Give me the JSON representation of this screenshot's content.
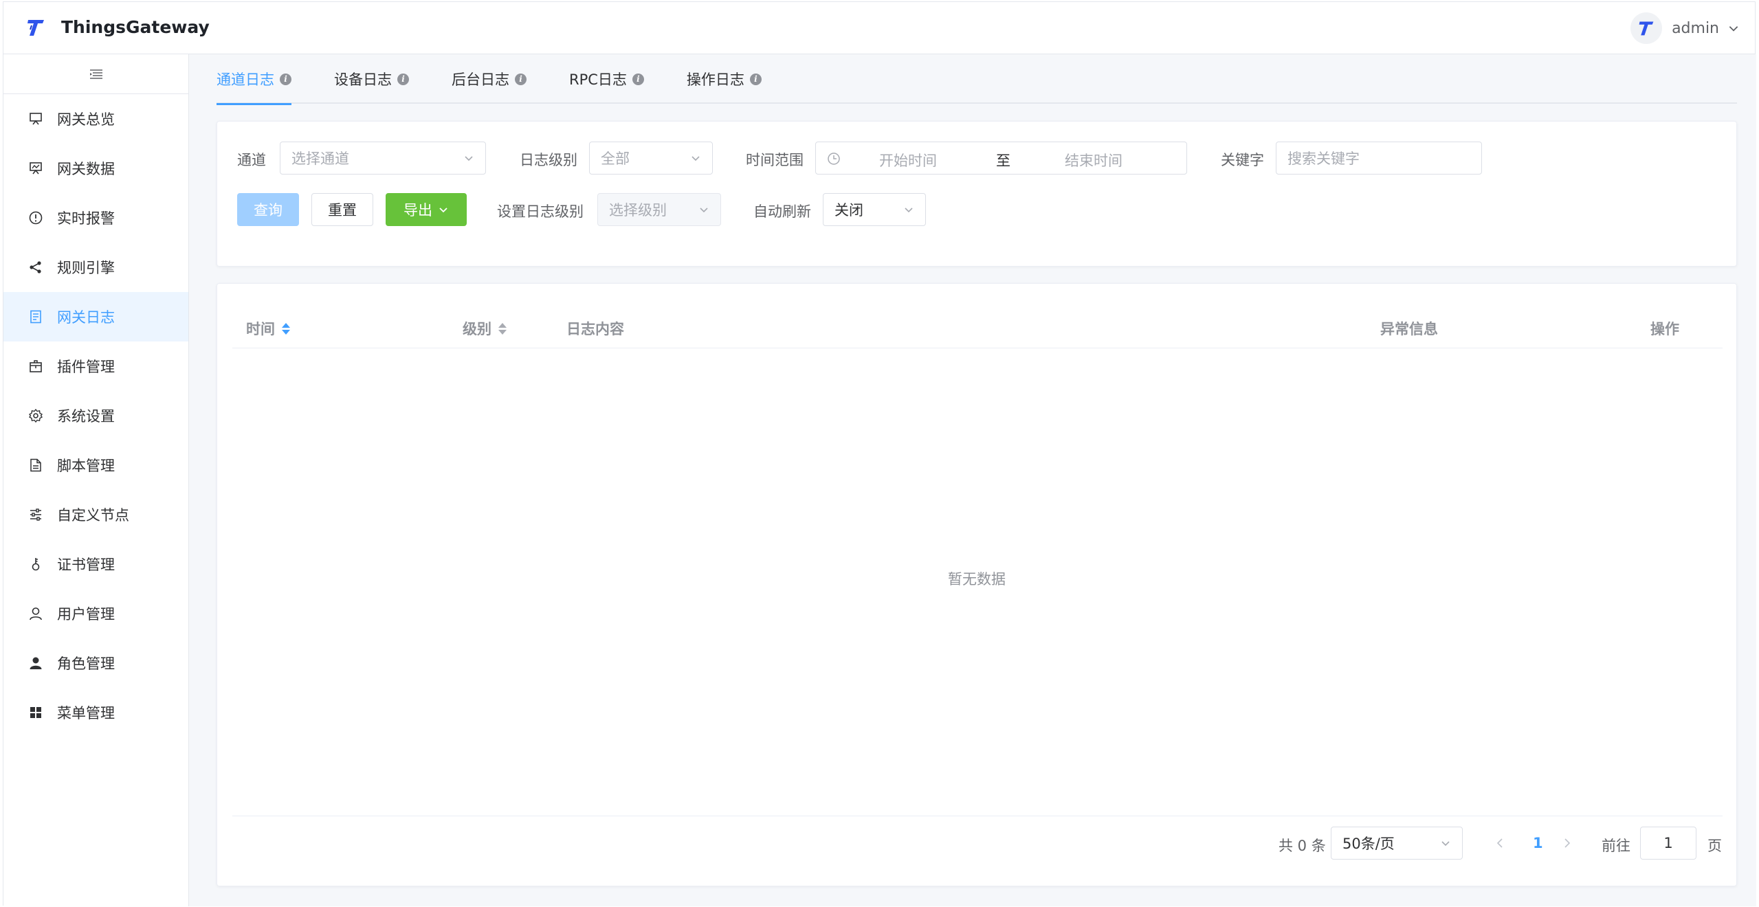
{
  "header": {
    "app_title": "ThingsGateway",
    "user_name": "admin",
    "brand_color": "#2f54eb"
  },
  "sidebar": {
    "items": [
      {
        "label": "网关总览",
        "icon": "monitor-icon"
      },
      {
        "label": "网关数据",
        "icon": "chart-monitor-icon"
      },
      {
        "label": "实时报警",
        "icon": "alert-circle-icon"
      },
      {
        "label": "规则引擎",
        "icon": "share-icon"
      },
      {
        "label": "网关日志",
        "icon": "document-icon",
        "active": true
      },
      {
        "label": "插件管理",
        "icon": "package-icon"
      },
      {
        "label": "系统设置",
        "icon": "gear-icon"
      },
      {
        "label": "脚本管理",
        "icon": "file-text-icon"
      },
      {
        "label": "自定义节点",
        "icon": "sliders-icon"
      },
      {
        "label": "证书管理",
        "icon": "key-icon"
      },
      {
        "label": "用户管理",
        "icon": "user-icon"
      },
      {
        "label": "角色管理",
        "icon": "role-icon"
      },
      {
        "label": "菜单管理",
        "icon": "grid-icon"
      }
    ]
  },
  "tabs": [
    {
      "label": "通道日志",
      "active": true
    },
    {
      "label": "设备日志"
    },
    {
      "label": "后台日志"
    },
    {
      "label": "RPC日志"
    },
    {
      "label": "操作日志"
    }
  ],
  "filters": {
    "channel_label": "通道",
    "channel_placeholder": "选择通道",
    "level_label": "日志级别",
    "level_value": "全部",
    "time_label": "时间范围",
    "time_start_placeholder": "开始时间",
    "time_separator": "至",
    "time_end_placeholder": "结束时间",
    "keyword_label": "关键字",
    "keyword_placeholder": "搜索关键字",
    "query_button": "查询",
    "reset_button": "重置",
    "export_button": "导出",
    "set_level_label": "设置日志级别",
    "set_level_placeholder": "选择级别",
    "auto_refresh_label": "自动刷新",
    "auto_refresh_value": "关闭"
  },
  "table": {
    "columns": [
      "时间",
      "级别",
      "日志内容",
      "异常信息",
      "操作"
    ],
    "empty_text": "暂无数据"
  },
  "pagination": {
    "total": "共 0 条",
    "page_size": "50条/页",
    "current_page": "1",
    "goto_label": "前往",
    "goto_value": "1",
    "page_suffix": "页"
  }
}
